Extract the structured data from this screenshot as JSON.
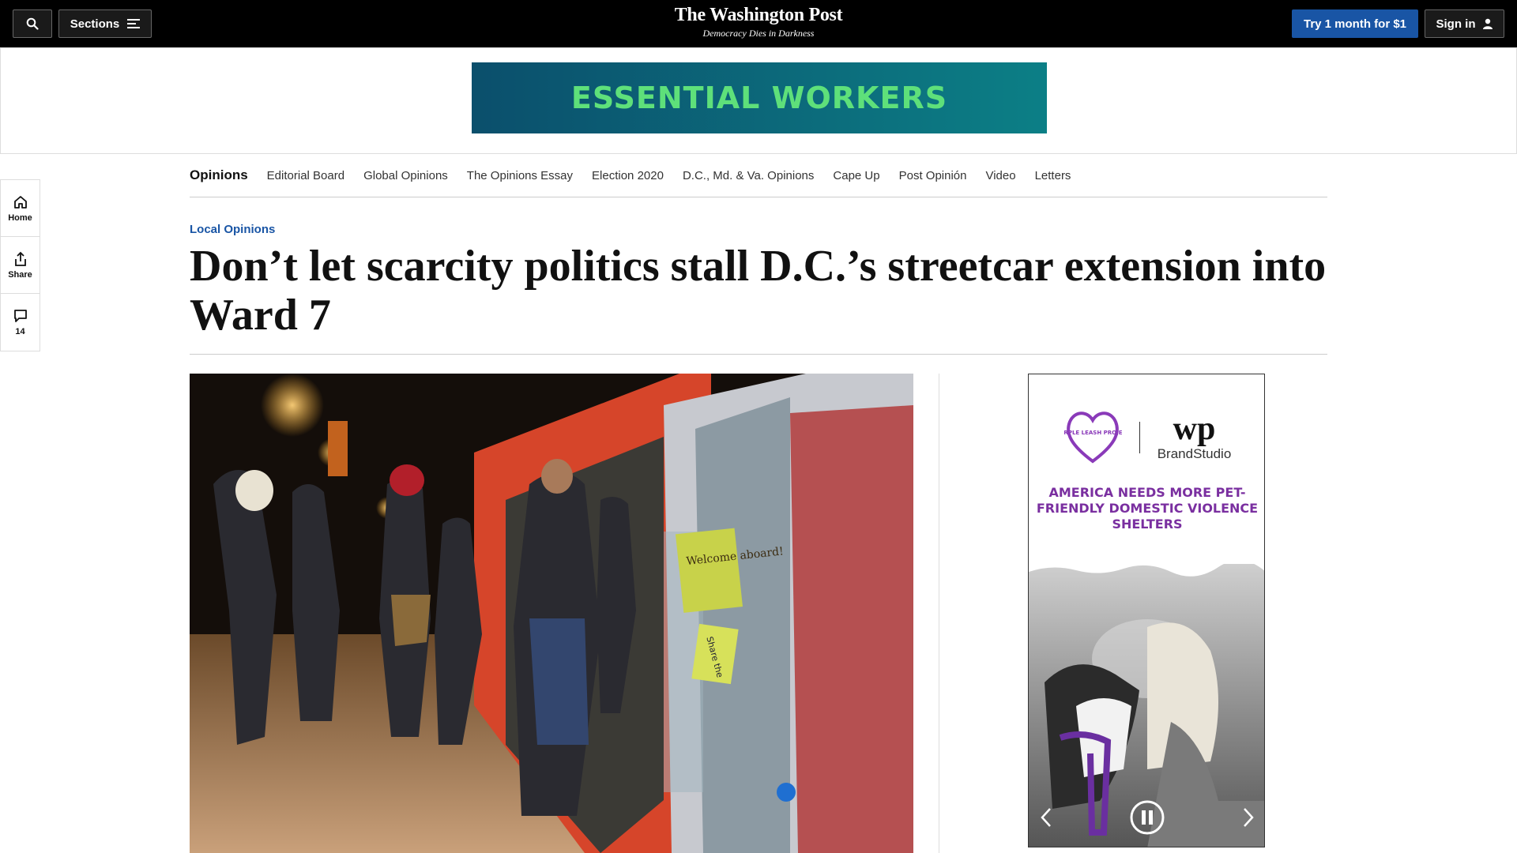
{
  "header": {
    "search_icon": "search-icon",
    "sections_label": "Sections",
    "logo_name": "The Washington Post",
    "logo_tagline": "Democracy Dies in Darkness",
    "try_label": "Try 1 month for $1",
    "signin_label": "Sign in"
  },
  "banner_ad": {
    "text": "ESSENTIAL WORKERS"
  },
  "section_nav": {
    "items": [
      "Opinions",
      "Editorial Board",
      "Global Opinions",
      "The Opinions Essay",
      "Election 2020",
      "D.C., Md. & Va. Opinions",
      "Cape Up",
      "Post Opinión",
      "Video",
      "Letters"
    ]
  },
  "rail": {
    "home_label": "Home",
    "share_label": "Share",
    "comments_count": "14"
  },
  "article": {
    "kicker": "Local Opinions",
    "headline": "Don’t let scarcity politics stall D.C.’s streetcar extension into Ward 7",
    "photo_signage": [
      "Welcome aboard!",
      "Share the"
    ]
  },
  "side_ad": {
    "partner": "PURPLE LEASH PROJECT",
    "wp_mark": "wp",
    "brandstudio": "BrandStudio",
    "headline": "AMERICA NEEDS MORE PET-FRIENDLY DOMESTIC VIOLENCE SHELTERS"
  },
  "colors": {
    "topbar": "#000000",
    "accent_blue": "#1955a5",
    "banner_green": "#5ee07a",
    "ad_purple": "#7a2fa0"
  }
}
